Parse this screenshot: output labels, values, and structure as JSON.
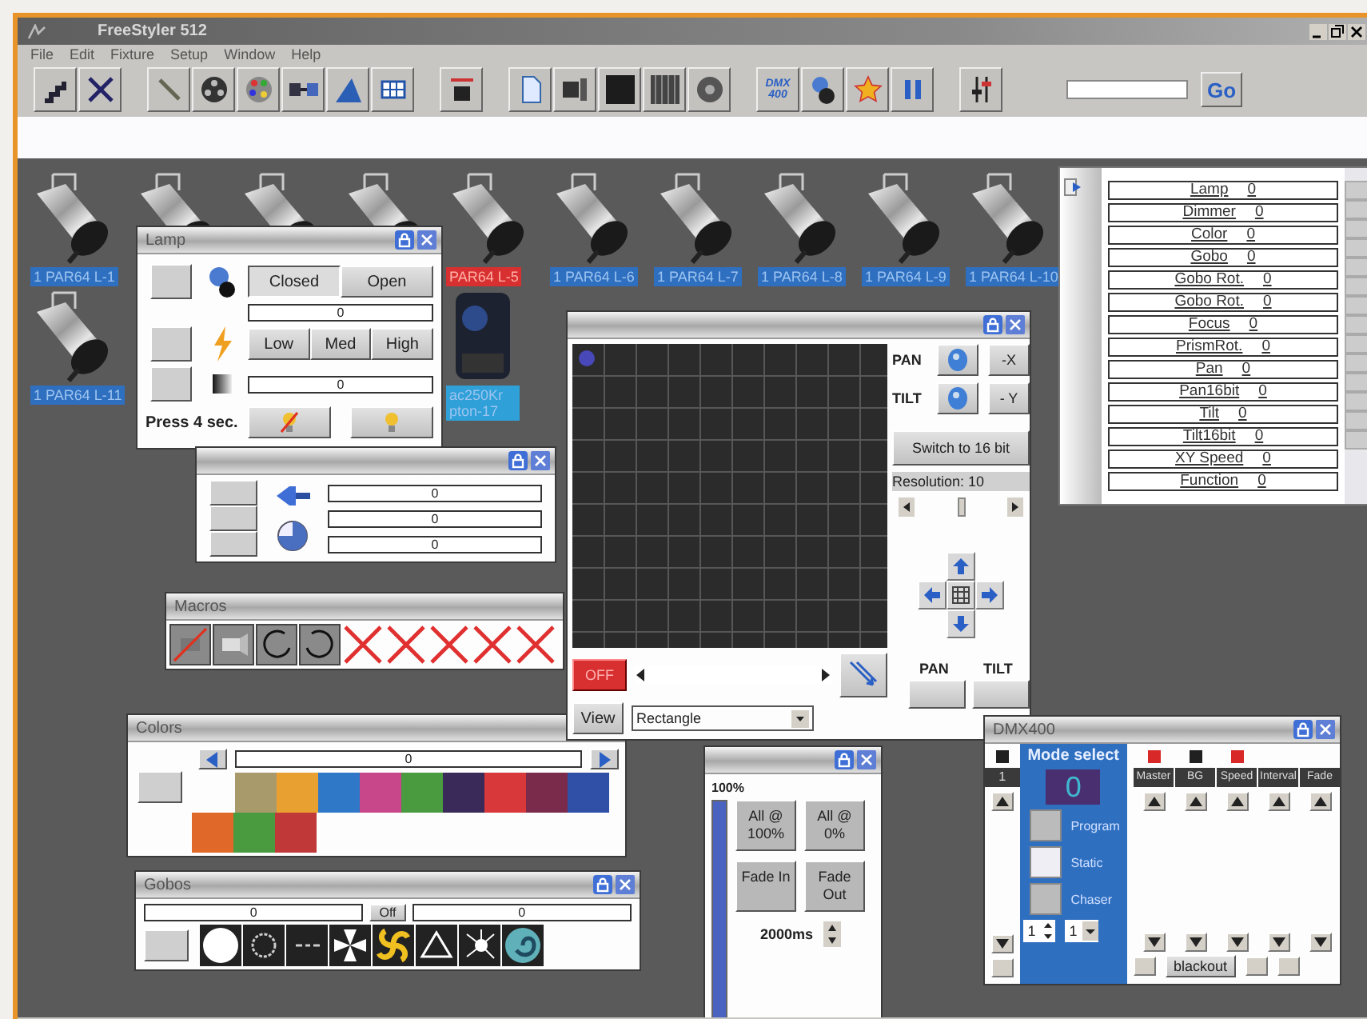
{
  "window": {
    "title": "FreeStyler 512"
  },
  "menu": [
    "File",
    "Edit",
    "Fixture",
    "Setup",
    "Window",
    "Help"
  ],
  "toolbar": {
    "dmx_button": "DMX 400",
    "go_button": "Go"
  },
  "fixtures": [
    {
      "kind": "par",
      "label": "1 PAR64 L-1",
      "selected": false
    },
    {
      "kind": "par"
    },
    {
      "kind": "par"
    },
    {
      "kind": "par"
    },
    {
      "kind": "par",
      "label": "PAR64 L-5",
      "selected": true
    },
    {
      "kind": "par",
      "label": "1 PAR64 L-6",
      "selected": false
    },
    {
      "kind": "par",
      "label": "1 PAR64 L-7",
      "selected": false
    },
    {
      "kind": "par",
      "label": "1 PAR64 L-8",
      "selected": false
    },
    {
      "kind": "par",
      "label": "1 PAR64 L-9",
      "selected": false
    },
    {
      "kind": "par",
      "label": "1 PAR64 L-10",
      "selected": false
    },
    {
      "kind": "par",
      "label": "1 PAR64 L-11",
      "selected": false
    },
    {
      "kind": "moving_head",
      "label": "ac250Kr pton-17",
      "selected": false
    }
  ],
  "lamp_panel": {
    "title": "Lamp",
    "shutter": [
      {
        "label": "Closed",
        "selected": true
      },
      {
        "label": "Open",
        "selected": false
      }
    ],
    "dimmer_reading": "0",
    "strobe": [
      "Low",
      "Med",
      "High"
    ],
    "strobe_reading": "0",
    "hint": "Press 4 sec."
  },
  "effects_panel": {
    "readings": [
      "0",
      "0",
      "0"
    ]
  },
  "macros": {
    "title": "Macros"
  },
  "colors": {
    "title": "Colors",
    "reading": "0",
    "swatch_rows": [
      [
        {
          "color": "#a89a6a"
        },
        {
          "color": "#e8a030"
        },
        {
          "color": "#2f78c8"
        },
        {
          "color": "#c8468a"
        },
        {
          "color": "#4a9a40"
        },
        {
          "color": "#3a2a5a"
        },
        {
          "color": "#d8383a"
        },
        {
          "color": "#7a2a4a"
        },
        {
          "color": "#3050a8"
        }
      ],
      [
        {
          "color": "#e06828"
        },
        {
          "color": "#4a9a40"
        },
        {
          "color": "#c03838"
        }
      ]
    ]
  },
  "gobos": {
    "title": "Gobos",
    "left_reading": "0",
    "off_button": "Off",
    "right_reading": "0"
  },
  "xy_panel": {
    "pan_label": "PAN",
    "tilt_label": "TILT",
    "minus_x": "-X",
    "minus_y": "- Y",
    "switch_button": "Switch to 16 bit",
    "resolution": "Resolution: 10",
    "resolution_slider": {
      "level": 0.5
    },
    "off_button": "OFF",
    "view_button": "View",
    "view_select": "Rectangle",
    "pan_button_label": "PAN",
    "tilt_button_label": "TILT"
  },
  "channels": [
    {
      "name": "Lamp",
      "value": "0"
    },
    {
      "name": "Dimmer",
      "value": "0"
    },
    {
      "name": "Color",
      "value": "0"
    },
    {
      "name": "Gobo",
      "value": "0"
    },
    {
      "name": "Gobo Rot.",
      "value": "0"
    },
    {
      "name": "Gobo Rot.",
      "value": "0"
    },
    {
      "name": "Focus",
      "value": "0"
    },
    {
      "name": "PrismRot.",
      "value": "0"
    },
    {
      "name": "Pan",
      "value": "0"
    },
    {
      "name": "Pan16bit",
      "value": "0"
    },
    {
      "name": "Tilt",
      "value": "0"
    },
    {
      "name": "Tilt16bit",
      "value": "0"
    },
    {
      "name": "XY Speed",
      "value": "0"
    },
    {
      "name": "Function",
      "value": "0"
    }
  ],
  "master": {
    "reading": "100%",
    "level": 1,
    "buttons": [
      "All @ 100%",
      "All @ 0%",
      "Fade In",
      "Fade Out"
    ],
    "fade_time": "2000ms"
  },
  "dmx": {
    "title": "DMX400",
    "mode_title": "Mode select",
    "mode_value": "0",
    "modes": [
      {
        "label": "Program",
        "selected": false
      },
      {
        "label": "Static",
        "selected": true
      },
      {
        "label": "Chaser",
        "selected": false
      }
    ],
    "spinner_value": "1",
    "select_value": "1",
    "blackout": "blackout",
    "columns": [
      {
        "label": "Master",
        "color": "#d82828"
      },
      {
        "label": "BG",
        "color": "#202020"
      },
      {
        "label": "Speed",
        "color": "#d82828"
      },
      {
        "label": "Interval"
      },
      {
        "label": "Fade"
      }
    ],
    "channel": {
      "label": "1",
      "color": "#202020"
    }
  }
}
